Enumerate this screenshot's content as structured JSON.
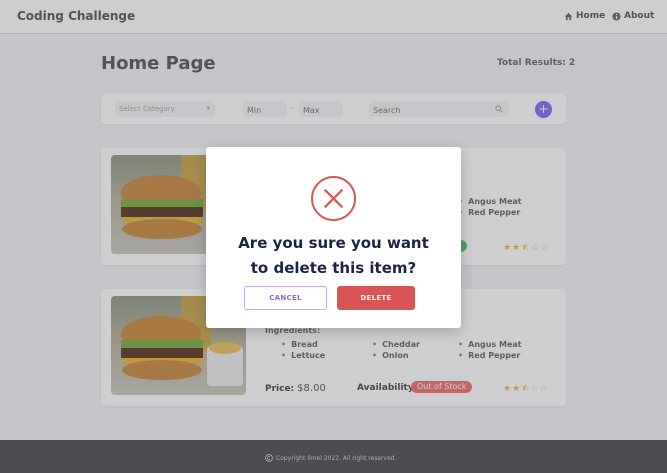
{
  "navbar": {
    "brand": "Coding Challenge",
    "home_label": "Home",
    "about_label": "About"
  },
  "header": {
    "title": "Home Page",
    "total_results_label": "Total Results:",
    "total_results_value": "2"
  },
  "filters": {
    "category_placeholder": "Select Category",
    "min_placeholder": "Min",
    "max_placeholder": "Max",
    "search_placeholder": "Search",
    "add_label": "+"
  },
  "products": [
    {
      "ingredients_visible": [
        "Angus Meat",
        "Red Pepper"
      ],
      "availability_badge": "",
      "rating": 2.5
    },
    {
      "ingredients_label": "Ingredients:",
      "ingredients": [
        "Bread",
        "Lettuce",
        "Cheddar",
        "Onion",
        "Angus Meat",
        "Red Pepper"
      ],
      "price_label": "Price:",
      "price": "$8.00",
      "availability_label": "Availability:",
      "availability": "Out of Stock",
      "rating": 2.5
    }
  ],
  "footer": {
    "copyright": "Copyright Ilmel 2022. All right reserved."
  },
  "modal": {
    "message_line1": "Are you sure you want",
    "message_line2": "to delete this item?",
    "cancel_label": "CANCEL",
    "delete_label": "DELETE"
  },
  "colors": {
    "accent": "#9b5de5",
    "danger": "#d95555",
    "star": "#f2b631",
    "footer": "#4b4b50"
  }
}
